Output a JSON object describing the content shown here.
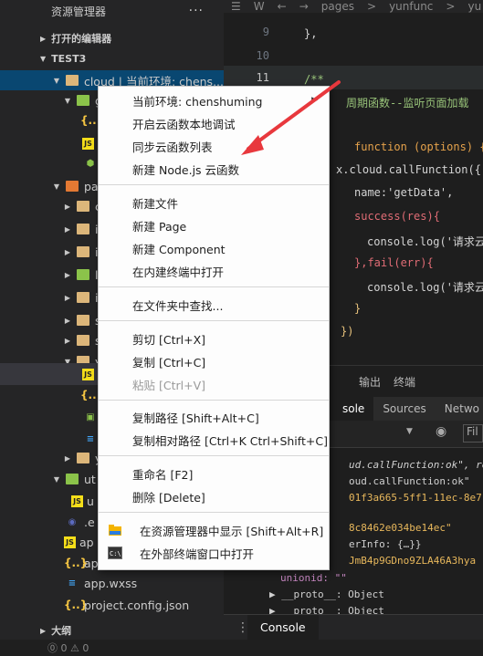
{
  "sidebar": {
    "title": "资源管理器",
    "more": "···",
    "open_editors": "打开的编辑器",
    "workspace": "TEST3",
    "rows": [
      {
        "label": "cloud | 当前环境: chens...",
        "depth": 1
      },
      {
        "label": "g",
        "depth": 2
      },
      {
        "label": "",
        "depth": 3
      },
      {
        "label": "",
        "depth": 3
      },
      {
        "label": "",
        "depth": 3
      },
      {
        "label": "pa",
        "depth": 1
      },
      {
        "label": "c",
        "depth": 2
      },
      {
        "label": "i",
        "depth": 2
      },
      {
        "label": "i",
        "depth": 2
      },
      {
        "label": "l",
        "depth": 2
      },
      {
        "label": "i",
        "depth": 2
      },
      {
        "label": "s",
        "depth": 2
      },
      {
        "label": "s",
        "depth": 2
      },
      {
        "label": "y",
        "depth": 2
      },
      {
        "label": "",
        "depth": 3
      },
      {
        "label": "",
        "depth": 3
      },
      {
        "label": "",
        "depth": 3
      },
      {
        "label": "",
        "depth": 3
      },
      {
        "label": "y",
        "depth": 2
      },
      {
        "label": "ut",
        "depth": 1
      },
      {
        "label": "u",
        "depth": 2
      },
      {
        "label": ".e",
        "depth": 1
      },
      {
        "label": "ap",
        "depth": 1
      },
      {
        "label": "app",
        "depth": 1
      },
      {
        "label": "app.wxss",
        "depth": 1
      },
      {
        "label": "project.config.json",
        "depth": 1
      }
    ],
    "outline": "大纲",
    "status": "⓪ 0 ⚠ 0"
  },
  "editor": {
    "breadcrumb": [
      "☰",
      "W",
      "←",
      "→",
      "pages",
      ">",
      "yunfunc",
      ">",
      "yu"
    ],
    "line_numbers": [
      "9",
      "10",
      "11",
      "12",
      "13",
      "14",
      "15",
      "16",
      "17",
      "18",
      "19",
      "20"
    ],
    "lines": [
      "},",
      "",
      "/**",
      "周期函数--监听页面加载",
      "",
      "function (options) {",
      "x.cloud.callFunction({",
      "name:'getData',",
      "success(res){",
      "console.log('请求云",
      "},fail(err){",
      "console.log('请求云",
      "}",
      "})"
    ]
  },
  "panel": {
    "tabs": [
      "输出",
      "终端"
    ],
    "devtools_tabs": [
      "sole",
      "Sources",
      "Netwo"
    ],
    "filter_placeholder": "Fil",
    "console_lines": [
      "ud.callFunction:ok\", re",
      "oud.callFunction:ok\"",
      "01f3a665-5ff1-11ec-8e7",
      "",
      "8c8462e034be14ec\"",
      "erInfo: {…}}",
      "JmB4p9GDno9ZLA46A3hya",
      "unionid: \"\"",
      "▶ __proto__: Object",
      "▶ __proto__: Object"
    ],
    "console_button": "Console"
  },
  "context_menu": {
    "items": [
      {
        "label": "当前环境: chenshuming",
        "submenu": true,
        "disabled": false
      },
      {
        "label": "开启云函数本地调试",
        "disabled": false
      },
      {
        "label": "同步云函数列表",
        "disabled": false
      },
      {
        "label": "新建 Node.js 云函数",
        "disabled": false
      },
      {
        "label": "新建文件",
        "disabled": false
      },
      {
        "label": "新建 Page",
        "disabled": false
      },
      {
        "label": "新建 Component",
        "disabled": false
      },
      {
        "label": "在内建终端中打开",
        "disabled": false
      },
      {
        "label": "在文件夹中查找...",
        "disabled": false
      },
      {
        "label": "剪切  [Ctrl+X]",
        "disabled": false
      },
      {
        "label": "复制  [Ctrl+C]",
        "disabled": false
      },
      {
        "label": "粘贴  [Ctrl+V]",
        "disabled": true
      },
      {
        "label": "复制路径  [Shift+Alt+C]",
        "disabled": false
      },
      {
        "label": "复制相对路径  [Ctrl+K Ctrl+Shift+C]",
        "disabled": false
      },
      {
        "label": "重命名  [F2]",
        "disabled": false
      },
      {
        "label": "删除  [Delete]",
        "disabled": false
      },
      {
        "label": "在资源管理器中显示  [Shift+Alt+R]",
        "disabled": false,
        "icon": "folder-icon"
      },
      {
        "label": "在外部终端窗口中打开",
        "disabled": false,
        "icon": "terminal-icon"
      }
    ]
  },
  "colors": {
    "selection": "#094771",
    "arrow": "#e8383d",
    "menu_bg": "#fdfdfd"
  }
}
